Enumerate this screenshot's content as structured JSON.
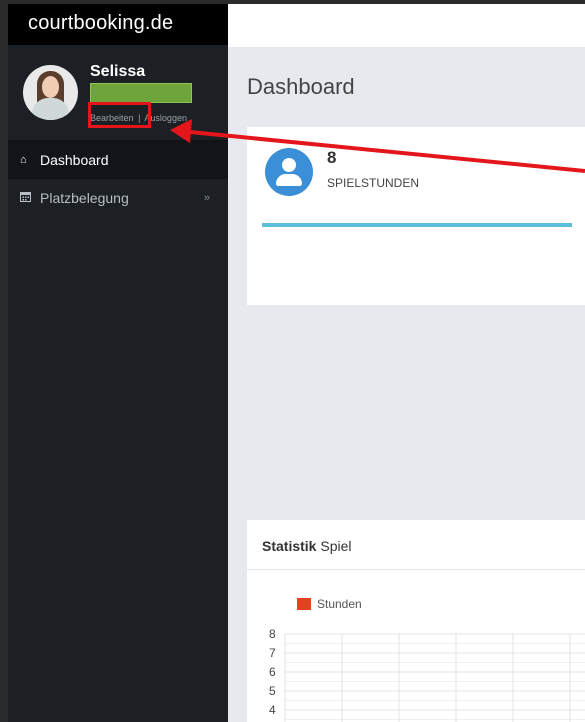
{
  "brand": {
    "name": "courtbooking.de"
  },
  "profile": {
    "name": "Selissa",
    "edit_label": "Bearbeiten",
    "separator": "|",
    "logout_label": "Ausloggen"
  },
  "sidebar": {
    "items": [
      {
        "label": "Dashboard",
        "icon": "home-icon",
        "active": true
      },
      {
        "label": "Platzbelegung",
        "icon": "calendar-icon",
        "active": false,
        "expandable": true
      }
    ]
  },
  "main": {
    "title": "Dashboard",
    "stat": {
      "value": "8",
      "label": "SPIELSTUNDEN",
      "icon": "user-icon",
      "progress": 1.0,
      "progress_color": "#5bc0de"
    },
    "panel": {
      "title_bold": "Statistik",
      "title_rest": " Spiel"
    }
  },
  "chart_data": {
    "type": "bar",
    "title": "",
    "series": [
      {
        "name": "Stunden",
        "color": "#e3421f",
        "values": []
      }
    ],
    "y_ticks": [
      "8",
      "7",
      "6",
      "5",
      "4"
    ],
    "ylim": [
      0,
      8
    ],
    "grid": true,
    "legend_position": "top-left"
  },
  "annotation": {
    "color": "#e4161c"
  }
}
